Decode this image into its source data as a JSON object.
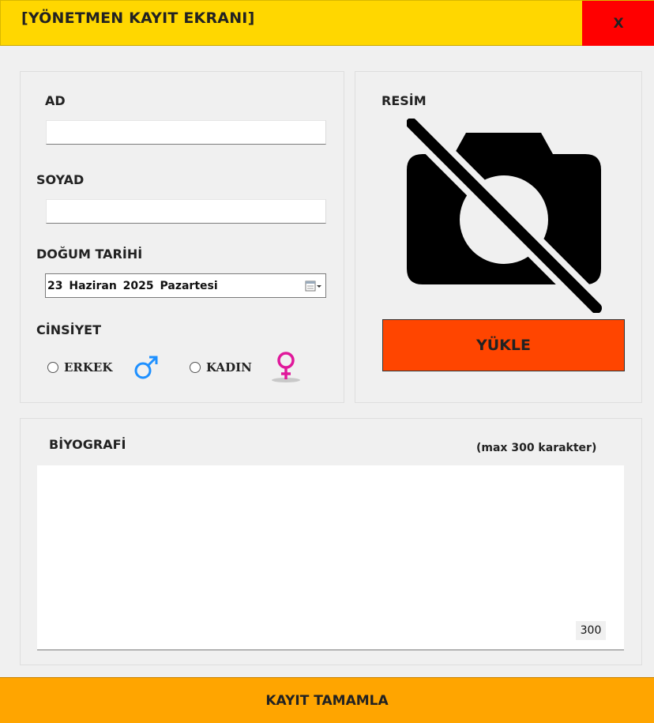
{
  "window": {
    "title": "[YÖNETMEN KAYIT EKRANI]",
    "close_label": "X"
  },
  "form": {
    "ad_label": "AD",
    "ad_value": "",
    "soyad_label": "SOYAD",
    "soyad_value": "",
    "dogum_label": "DOĞUM TARİHİ",
    "dogum_value": "23  Haziran  2025  Pazartesi",
    "cinsiyet_label": "CİNSİYET",
    "gender_options": [
      {
        "label": "ERKEK",
        "icon": "male-symbol-icon",
        "selected": false
      },
      {
        "label": "KADIN",
        "icon": "female-symbol-icon",
        "selected": false
      }
    ]
  },
  "photo": {
    "label": "RESİM",
    "icon": "no-camera-icon",
    "upload_label": "YÜKLE"
  },
  "bio": {
    "label": "BİYOGRAFİ",
    "hint": "(max 300 karakter)",
    "value": "",
    "remaining": "300"
  },
  "submit_label": "KAYIT TAMAMLA",
  "colors": {
    "titlebar": "#ffd700",
    "close": "#ff0000",
    "upload": "#ff4500",
    "submit": "#ffa500",
    "male": "#1e90ff",
    "female": "#e0189b"
  }
}
